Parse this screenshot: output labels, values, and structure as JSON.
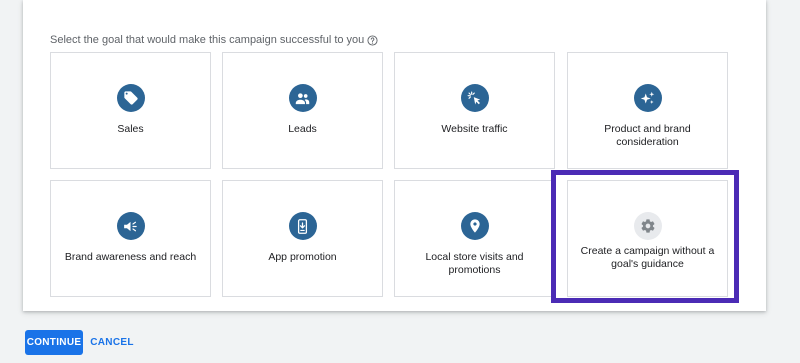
{
  "prompt": {
    "text": "Select the goal that would make this campaign successful to you",
    "help_icon": "help-circle-icon"
  },
  "colors": {
    "icon_bg": "#2c6595",
    "icon_bg_muted": "#e8eaed",
    "icon_muted_fg": "#80868b",
    "highlight": "#4b2bb5",
    "primary": "#1a73e8"
  },
  "goals": [
    {
      "label": "Sales",
      "icon": "sales-tag-icon"
    },
    {
      "label": "Leads",
      "icon": "people-icon"
    },
    {
      "label": "Website traffic",
      "icon": "cursor-click-icon"
    },
    {
      "label": "Product and brand consideration",
      "icon": "sparkle-icon"
    },
    {
      "label": "Brand awareness and reach",
      "icon": "speaker-icon"
    },
    {
      "label": "App promotion",
      "icon": "phone-download-icon"
    },
    {
      "label": "Local store visits and promotions",
      "icon": "location-pin-icon"
    },
    {
      "label": "Create a campaign without a goal's guidance",
      "icon": "gear-icon"
    }
  ],
  "actions": {
    "continue_label": "CONTINUE",
    "cancel_label": "CANCEL"
  }
}
